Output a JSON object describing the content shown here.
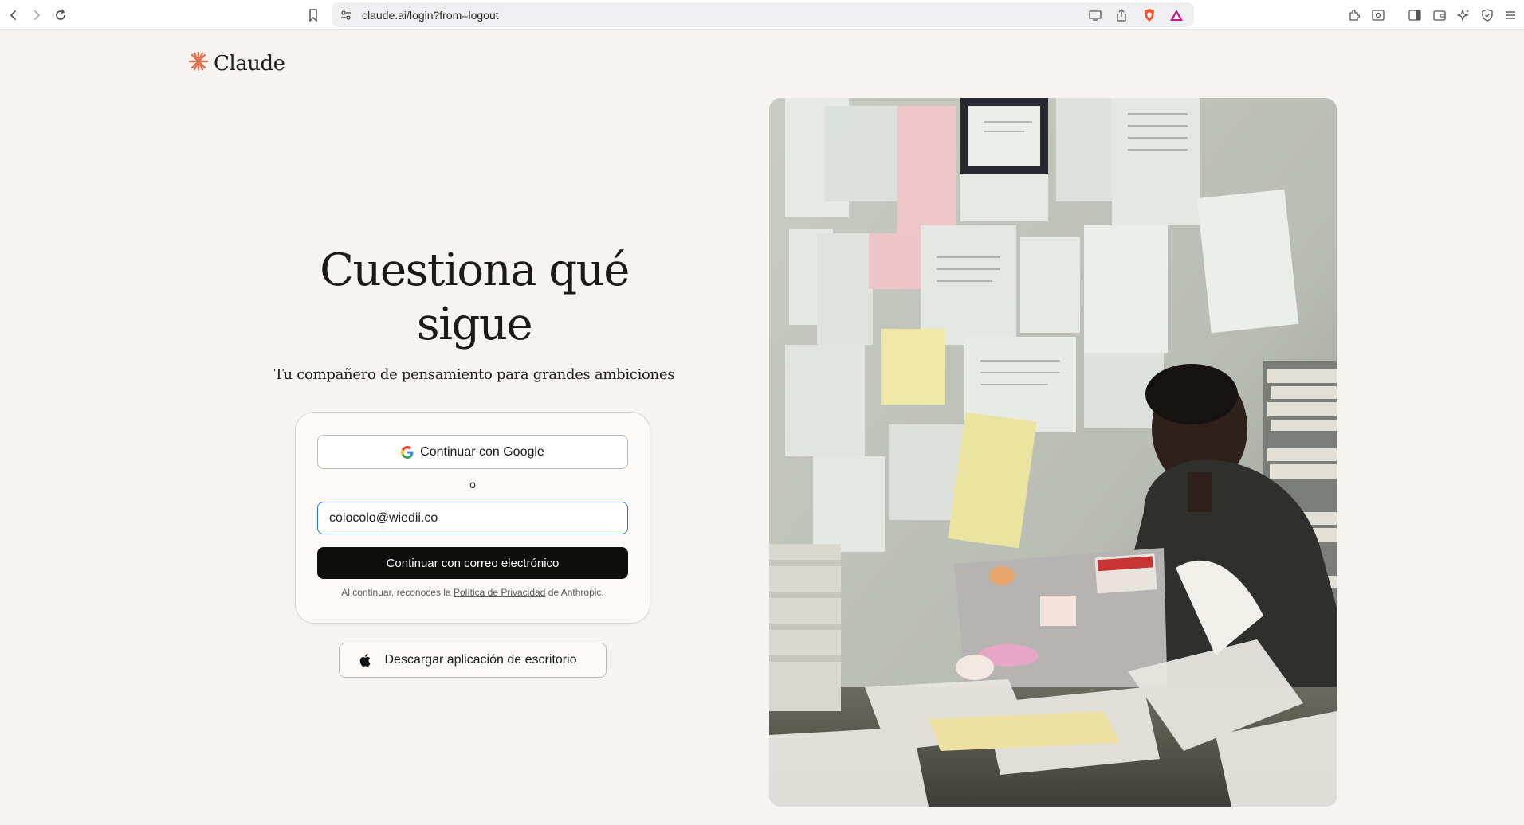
{
  "browser": {
    "url": "claude.ai/login?from=logout",
    "back_icon": "chevron-left-icon",
    "forward_icon": "chevron-right-icon",
    "reload_icon": "reload-icon"
  },
  "logo": {
    "text": "Claude",
    "accent": "#d97757"
  },
  "hero": {
    "title_line1": "Cuestiona qué",
    "title_line2": "sigue",
    "subtitle": "Tu compañero de pensamiento para grandes ambiciones"
  },
  "login": {
    "google_label": "Continuar con Google",
    "or_label": "o",
    "email_value": "colocolo@wiedii.co",
    "email_button": "Continuar con correo electrónico",
    "legal_prefix": "Al continuar, reconoces la",
    "legal_link": "Política de Privacidad",
    "legal_suffix": "de Anthropic."
  },
  "desktop": {
    "label": "Descargar aplicación de escritorio"
  },
  "colors": {
    "background": "#f5f4f0",
    "primary_button": "#0f0f0e",
    "focus_ring": "#2c6fd6"
  }
}
